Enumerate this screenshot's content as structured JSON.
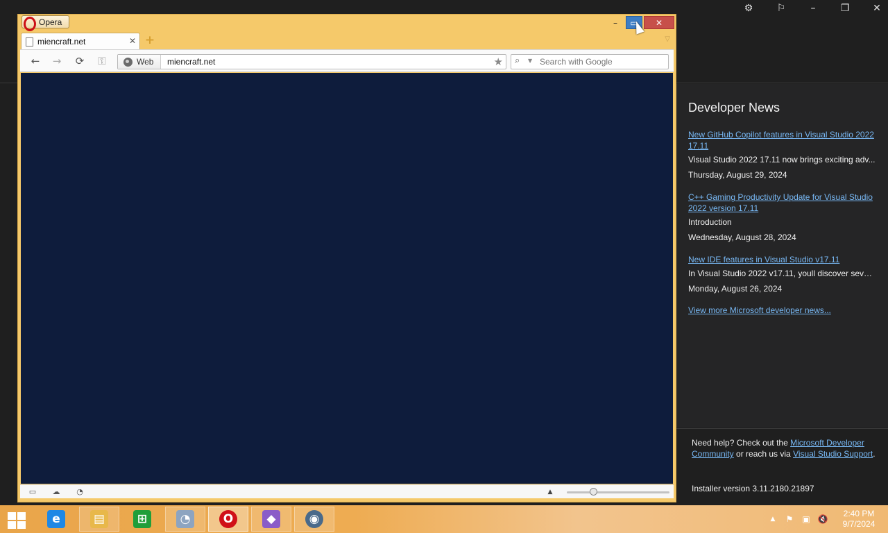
{
  "vs_installer": {
    "titlebar_icons": [
      "gear-icon",
      "feedback-icon",
      "minimize-icon",
      "restore-icon",
      "close-icon"
    ],
    "news": {
      "title": "Developer News",
      "items": [
        {
          "link": "New GitHub Copilot features in Visual Studio 2022 17.11",
          "description": "Visual Studio 2022 17.11 now brings exciting adv...",
          "date": "Thursday, August 29, 2024"
        },
        {
          "link": "C++ Gaming Productivity Update for Visual Studio 2022 version 17.11",
          "description": "Introduction",
          "date": "Wednesday, August 28, 2024"
        },
        {
          "link": "New IDE features in Visual Studio v17.11",
          "description": "In Visual Studio 2022 v17.11, youll discover sever...",
          "date": "Monday, August 26, 2024"
        }
      ],
      "more_link": "View more Microsoft developer news..."
    },
    "help": {
      "prefix": "Need help? Check out the ",
      "community_link": "Microsoft Developer Community",
      "middle": " or reach us via ",
      "support_link": "Visual Studio Support",
      "suffix": "."
    },
    "installer_version": "Installer version 3.11.2180.21897"
  },
  "opera": {
    "menu_label": "Opera",
    "window_controls": {
      "minimize": "–",
      "maximize": "▭",
      "close": "✕"
    },
    "tab": {
      "title": "miencraft.net",
      "close": "✕"
    },
    "new_tab_symbol": "+",
    "tab_menu_symbol": "▽",
    "nav": {
      "back": "←",
      "forward": "→",
      "reload": "⟳",
      "key": "⚿"
    },
    "address": {
      "badge": "Web",
      "url": "miencraft.net",
      "star": "★"
    },
    "search": {
      "placeholder": "Search with Google",
      "icon": "⌕",
      "dropdown": "▼"
    },
    "content_color": "#0e1c3c",
    "status_icons": [
      "panel-toggle-icon",
      "opera-unite-icon",
      "opera-turbo-icon"
    ],
    "status_up": "▲",
    "zoom_level": 0.26
  },
  "taskbar": {
    "apps": [
      {
        "name": "Internet Explorer",
        "glyph": "e",
        "color": "#1e88e5",
        "state": "pinned"
      },
      {
        "name": "File Explorer",
        "glyph": "▤",
        "color": "#e8b84a",
        "state": "running"
      },
      {
        "name": "Store",
        "glyph": "⊞",
        "color": "#1f9e3a",
        "state": "pinned"
      },
      {
        "name": "Resource Monitor",
        "glyph": "◔",
        "color": "#8da4c0",
        "state": "running"
      },
      {
        "name": "Opera",
        "glyph": "O",
        "color": "#d01018",
        "state": "active"
      },
      {
        "name": "Visual Studio Installer",
        "glyph": "◆",
        "color": "#8a5cc8",
        "state": "running"
      },
      {
        "name": "Chrome",
        "glyph": "◉",
        "color": "#4a6a8a",
        "state": "running"
      }
    ],
    "tray": {
      "overflow": "▲",
      "flag": "⚑",
      "network": "▣",
      "volume": "🔇"
    },
    "clock": {
      "time": "2:40 PM",
      "date": "9/7/2024"
    }
  }
}
